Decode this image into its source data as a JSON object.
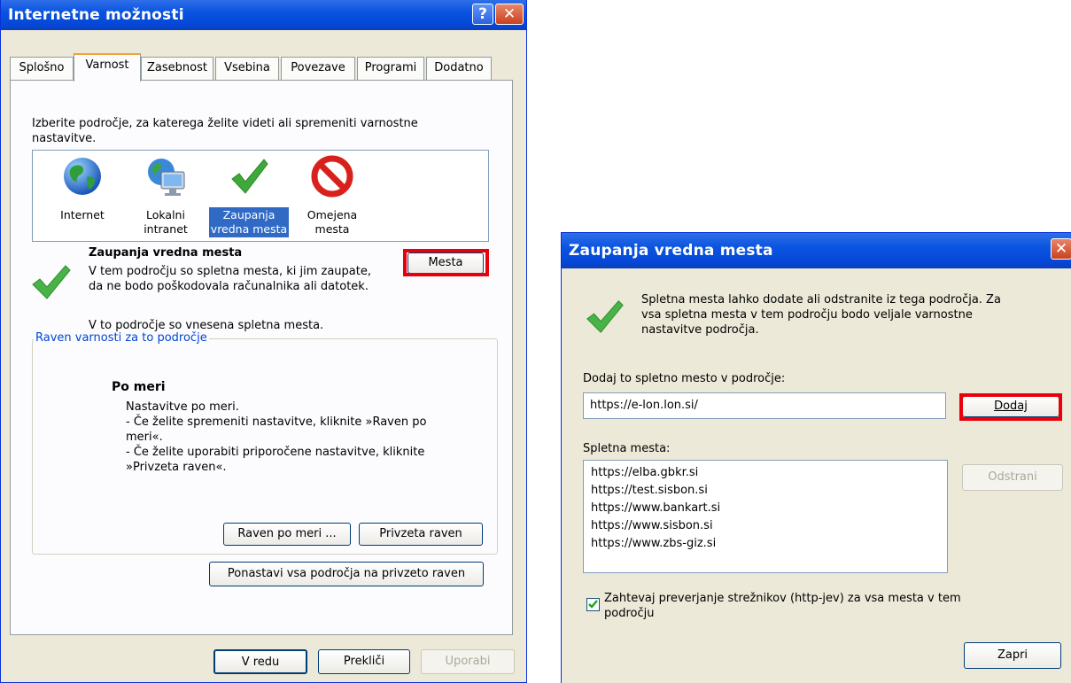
{
  "internet_options": {
    "title": "Internetne možnosti",
    "help_glyph": "?",
    "close_glyph": "✕",
    "tabs": [
      "Splošno",
      "Varnost",
      "Zasebnost",
      "Vsebina",
      "Povezave",
      "Programi",
      "Dodatno"
    ],
    "active_tab": "Varnost",
    "intro_line1": "Izberite področje, za katerega želite videti ali spremeniti varnostne",
    "intro_line2": "nastavitve.",
    "zones": [
      {
        "line1": "Internet",
        "line2": ""
      },
      {
        "line1": "Lokalni",
        "line2": "intranet"
      },
      {
        "line1": "Zaupanja",
        "line2": "vredna mesta"
      },
      {
        "line1": "Omejena",
        "line2": "mesta"
      }
    ],
    "selected_zone": "Zaupanja vredna mesta",
    "zone_title": "Zaupanja vredna mesta",
    "zone_desc1": "V tem področju so spletna mesta, ki jim zaupate,",
    "zone_desc2": "da ne bodo poškodovala računalnika ali datotek.",
    "sites_button": "Mesta",
    "zone_note": "V to področje so vnesena spletna mesta.",
    "security_group_label": "Raven varnosti za to področje",
    "custom_title": "Po meri",
    "custom_lines": [
      "Nastavitve po meri.",
      "- Če želite spremeniti nastavitve, kliknite »Raven po",
      "meri«.",
      "- Če želite uporabiti priporočene nastavitve, kliknite",
      "»Privzeta raven«."
    ],
    "custom_level_button": "Raven po meri ...",
    "default_level_button": "Privzeta raven",
    "reset_all_button": "Ponastavi vsa področja na privzeto raven",
    "ok_button": "V redu",
    "cancel_button": "Prekliči",
    "apply_button": "Uporabi"
  },
  "trusted_sites": {
    "title": "Zaupanja vredna mesta",
    "close_glyph": "✕",
    "desc_lines": [
      "Spletna mesta lahko dodate ali odstranite iz tega področja. Za",
      "vsa spletna mesta v tem področju bodo veljale varnostne",
      "nastavitve področja."
    ],
    "add_label": "Dodaj to spletno mesto v področje:",
    "add_value": "https://e-lon.lon.si/",
    "add_button": "Dodaj",
    "list_label": "Spletna mesta:",
    "sites": [
      "https://elba.gbkr.si",
      "https://test.sisbon.si",
      "https://www.bankart.si",
      "https://www.sisbon.si",
      "https://www.zbs-giz.si"
    ],
    "remove_button": "Odstrani",
    "require_https_line1": "Zahtevaj preverjanje strežnikov (http-jev) za vsa mesta v tem",
    "require_https_line2": "področju",
    "require_https_checked": true,
    "close_button": "Zapri"
  },
  "colors": {
    "titlebar": "#0a54e0",
    "highlight": "#e8000c",
    "group_label": "#0046d5",
    "selection": "#316ac5"
  }
}
